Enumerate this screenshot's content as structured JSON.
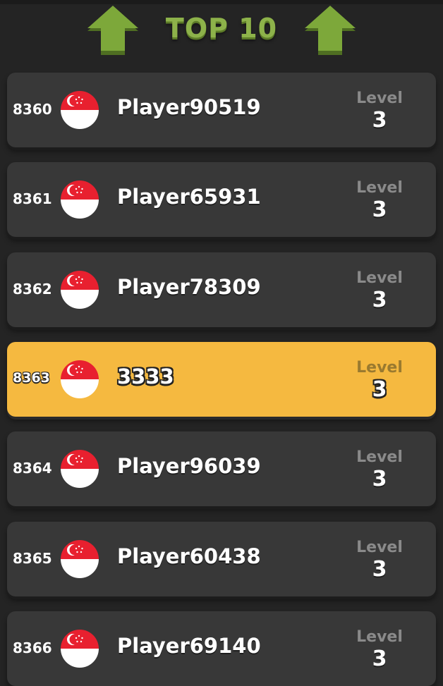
{
  "header": {
    "title": "TOP 10",
    "arrow_color": "#7da83a"
  },
  "leaderboard": {
    "level_label": "Level",
    "highlight_color": "#f5b940",
    "rows": [
      {
        "rank": "8360",
        "name": "Player90519",
        "level": "3",
        "flag": "singapore-flag-icon",
        "highlight": false
      },
      {
        "rank": "8361",
        "name": "Player65931",
        "level": "3",
        "flag": "singapore-flag-icon",
        "highlight": false
      },
      {
        "rank": "8362",
        "name": "Player78309",
        "level": "3",
        "flag": "singapore-flag-icon",
        "highlight": false
      },
      {
        "rank": "8363",
        "name": "3333",
        "level": "3",
        "flag": "singapore-flag-icon",
        "highlight": true
      },
      {
        "rank": "8364",
        "name": "Player96039",
        "level": "3",
        "flag": "singapore-flag-icon",
        "highlight": false
      },
      {
        "rank": "8365",
        "name": "Player60438",
        "level": "3",
        "flag": "singapore-flag-icon",
        "highlight": false
      },
      {
        "rank": "8366",
        "name": "Player69140",
        "level": "3",
        "flag": "singapore-flag-icon",
        "highlight": false
      }
    ]
  }
}
